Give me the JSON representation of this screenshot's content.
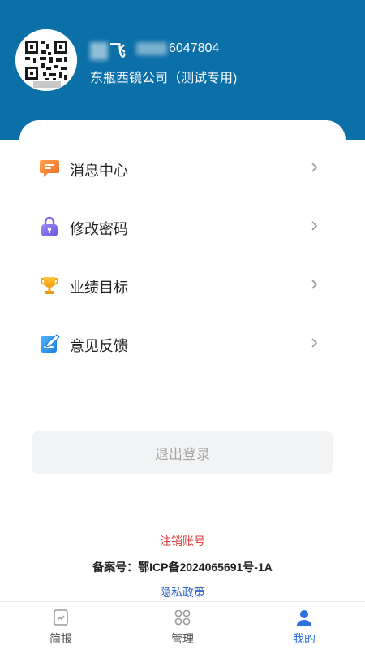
{
  "profile": {
    "name_visible": "飞",
    "phone_visible": "6047804",
    "company": "东瓶西镜公司（测试专用)"
  },
  "menu": [
    {
      "label": "消息中心",
      "icon": "message-icon"
    },
    {
      "label": "修改密码",
      "icon": "lock-icon"
    },
    {
      "label": "业绩目标",
      "icon": "trophy-icon"
    },
    {
      "label": "意见反馈",
      "icon": "feedback-icon"
    }
  ],
  "logout_label": "退出登录",
  "footer": {
    "cancel_account": "注销账号",
    "icp": "备案号：鄂ICP备2024065691号-1A",
    "privacy": "隐私政策"
  },
  "tabs": [
    {
      "label": "简报",
      "icon": "report-icon",
      "active": false
    },
    {
      "label": "管理",
      "icon": "grid-icon",
      "active": false
    },
    {
      "label": "我的",
      "icon": "user-icon",
      "active": true
    }
  ],
  "colors": {
    "header": "#0b6fa8",
    "accent": "#2f6fe4",
    "danger": "#e23b3b",
    "link": "#2a63c9"
  }
}
